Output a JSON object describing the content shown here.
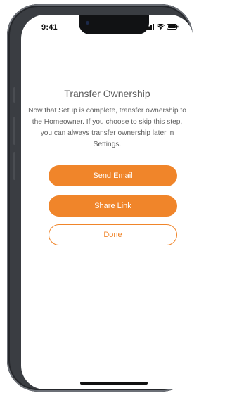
{
  "status_bar": {
    "time": "9:41",
    "icons": [
      "signal-bars-icon",
      "wifi-icon",
      "battery-icon"
    ]
  },
  "dialog": {
    "title": "Transfer Ownership",
    "message": "Now that Setup is complete, transfer ownership to the Homeowner. If you choose to skip this step, you can always transfer ownership later in Settings."
  },
  "actions": {
    "send_email": "Send Email",
    "share_link": "Share Link",
    "done": "Done"
  },
  "colors": {
    "accent": "#f0852a",
    "text": "#5c5c5c",
    "phone_frame": "#3a3d42"
  }
}
